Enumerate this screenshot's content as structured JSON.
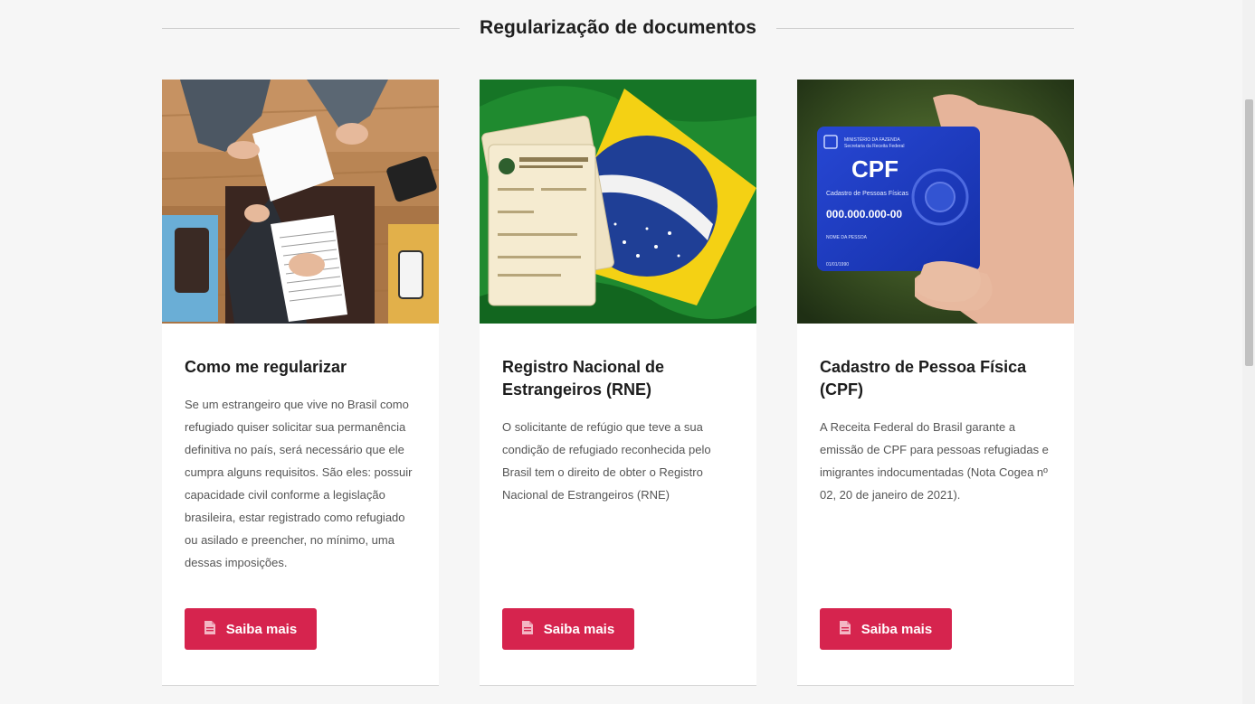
{
  "section": {
    "title": "Regularização de documentos"
  },
  "cards": [
    {
      "title": "Como me regularizar",
      "text": "Se um estrangeiro que vive no Brasil como refugiado quiser solicitar sua permanência definitiva no país, será necessário que ele cumpra alguns requisitos. São eles: possuir capacidade civil conforme a legislação brasileira, estar registrado como refugiado ou asilado e preencher, no mínimo, uma dessas imposições.",
      "button_label": "Saiba mais",
      "button_icon": "document-icon",
      "image": "business-meeting-photo"
    },
    {
      "title": "Registro Nacional de Estrangeiros (RNE)",
      "text": "O solicitante de refúgio que teve a sua condição de refugiado reconhecida pelo Brasil tem o direito de obter o Registro Nacional de Estrangeiros (RNE)",
      "button_label": "Saiba mais",
      "button_icon": "document-icon",
      "image": "brazil-flag-id-card-photo"
    },
    {
      "title": "Cadastro de Pessoa Física (CPF)",
      "text": "A Receita Federal do Brasil garante a emissão de CPF para pessoas refugiadas e imigrantes indocumentadas (Nota Cogea nº 02, 20 de janeiro de 2021).",
      "button_label": "Saiba mais",
      "button_icon": "document-icon",
      "image": "cpf-card-in-hand-photo",
      "card_text": {
        "heading": "CPF",
        "ministry": "MINISTÉRIO DA FAZENDA",
        "secretariat": "Secretaria da Receita Federal",
        "subtitle": "Cadastro de Pessoas Físicas",
        "number": "000.000.000-00",
        "name": "NOME DA PESSOA",
        "date": "01/01/1990"
      }
    }
  ],
  "colors": {
    "accent": "#d6244e",
    "background": "#f6f6f6"
  }
}
